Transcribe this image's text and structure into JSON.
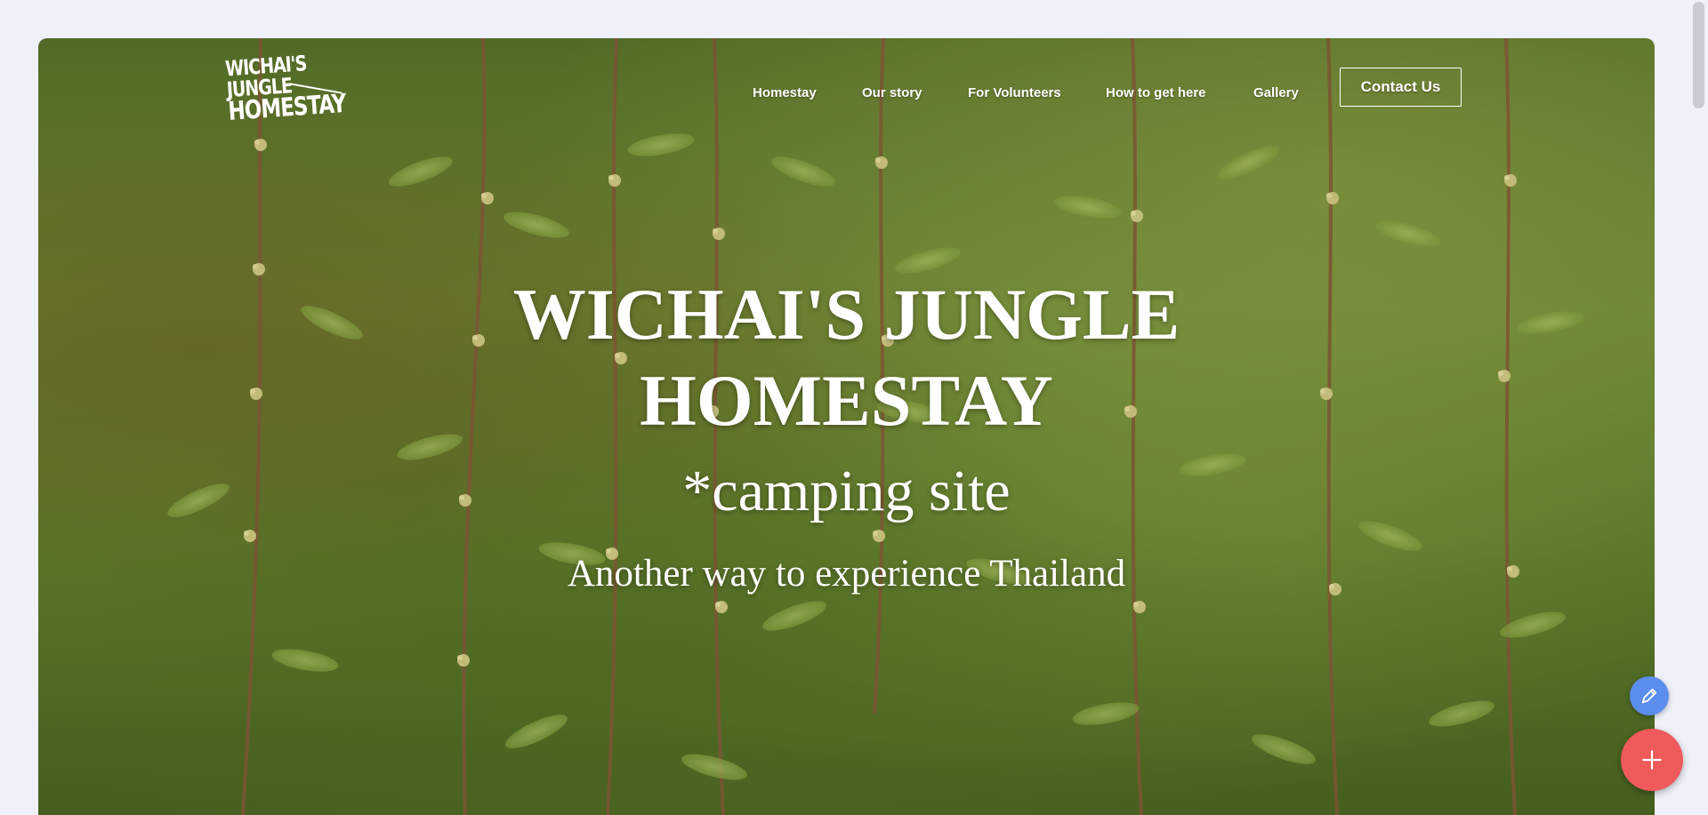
{
  "logo": {
    "line1": "WICHAI'S JUNGLE",
    "line2": "HOMESTAY"
  },
  "nav": {
    "items": [
      {
        "label": "Homestay"
      },
      {
        "label": "Our story"
      },
      {
        "label": "For Volunteers"
      },
      {
        "label": "How to get here"
      },
      {
        "label": "Gallery"
      }
    ],
    "contact_label": "Contact Us"
  },
  "hero": {
    "title_line1": "WICHAI'S JUNGLE",
    "title_line2": "HOMESTAY",
    "subtitle": "*camping site",
    "tagline": "Another way to experience Thailand",
    "background": "jungle-vines-photo"
  },
  "fab": {
    "edit_icon": "pencil-icon",
    "add_icon": "plus-icon"
  },
  "colors": {
    "page_background": "#eef1f8",
    "edit_button": "#5b8def",
    "add_button": "#ef5a5a",
    "text": "#ffffff"
  }
}
